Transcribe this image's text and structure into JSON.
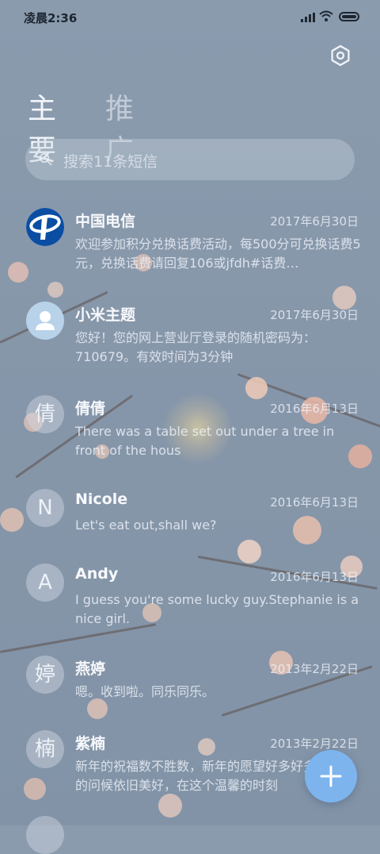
{
  "status_bar": {
    "time": "凌晨2:36"
  },
  "tabs": {
    "primary": "主要",
    "promotions": "推广"
  },
  "search": {
    "placeholder": "搜索11条短信"
  },
  "icons": {
    "settings": "settings-icon",
    "search": "search-icon",
    "compose": "plus-icon"
  },
  "colors": {
    "fab": "#7db4ee",
    "telecom_blue": "#0a4ea3"
  },
  "conversations": [
    {
      "name": "中国电信",
      "date": "2017年6月30日",
      "preview": "欢迎参加积分兑换话费活动，每500分可兑换话费5元，兑换话费请回复106或jfdh#话费…",
      "avatar": ""
    },
    {
      "name": "小米主题",
      "date": "2017年6月30日",
      "preview": "您好！您的网上营业厅登录的随机密码为：710679。有效时间为3分钟",
      "avatar": ""
    },
    {
      "name": "倩倩",
      "date": "2016年6月13日",
      "preview": "There was a table set out under a tree in front of the hous",
      "avatar": "倩"
    },
    {
      "name": "Nicole",
      "date": "2016年6月13日",
      "preview": "Let's eat out,shall we?",
      "avatar": "N"
    },
    {
      "name": "Andy",
      "date": "2016年6月13日",
      "preview": "I guess you're some lucky guy.Stephanie is a nice girl.",
      "avatar": "A"
    },
    {
      "name": "燕婷",
      "date": "2013年2月22日",
      "preview": "嗯。收到啦。同乐同乐。",
      "avatar": "婷"
    },
    {
      "name": "紫楠",
      "date": "2013年2月22日",
      "preview": "新年的祝福数不胜数，新年的愿望好多好多，新年的问候依旧美好，在这个温馨的时刻",
      "avatar": "楠"
    }
  ]
}
